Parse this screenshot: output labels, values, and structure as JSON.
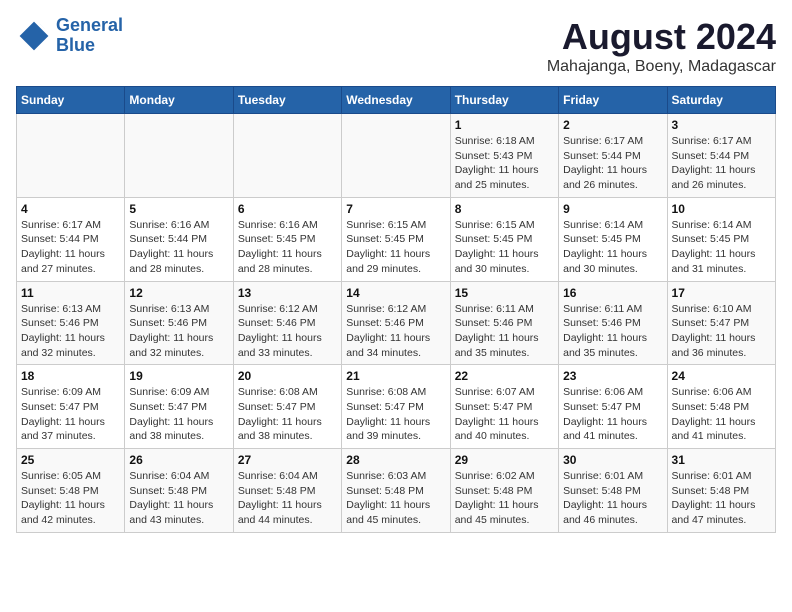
{
  "header": {
    "logo_line1": "General",
    "logo_line2": "Blue",
    "main_title": "August 2024",
    "subtitle": "Mahajanga, Boeny, Madagascar"
  },
  "calendar": {
    "days_of_week": [
      "Sunday",
      "Monday",
      "Tuesday",
      "Wednesday",
      "Thursday",
      "Friday",
      "Saturday"
    ],
    "weeks": [
      [
        {
          "day": "",
          "info": ""
        },
        {
          "day": "",
          "info": ""
        },
        {
          "day": "",
          "info": ""
        },
        {
          "day": "",
          "info": ""
        },
        {
          "day": "1",
          "info": "Sunrise: 6:18 AM\nSunset: 5:43 PM\nDaylight: 11 hours and 25 minutes."
        },
        {
          "day": "2",
          "info": "Sunrise: 6:17 AM\nSunset: 5:44 PM\nDaylight: 11 hours and 26 minutes."
        },
        {
          "day": "3",
          "info": "Sunrise: 6:17 AM\nSunset: 5:44 PM\nDaylight: 11 hours and 26 minutes."
        }
      ],
      [
        {
          "day": "4",
          "info": "Sunrise: 6:17 AM\nSunset: 5:44 PM\nDaylight: 11 hours and 27 minutes."
        },
        {
          "day": "5",
          "info": "Sunrise: 6:16 AM\nSunset: 5:44 PM\nDaylight: 11 hours and 28 minutes."
        },
        {
          "day": "6",
          "info": "Sunrise: 6:16 AM\nSunset: 5:45 PM\nDaylight: 11 hours and 28 minutes."
        },
        {
          "day": "7",
          "info": "Sunrise: 6:15 AM\nSunset: 5:45 PM\nDaylight: 11 hours and 29 minutes."
        },
        {
          "day": "8",
          "info": "Sunrise: 6:15 AM\nSunset: 5:45 PM\nDaylight: 11 hours and 30 minutes."
        },
        {
          "day": "9",
          "info": "Sunrise: 6:14 AM\nSunset: 5:45 PM\nDaylight: 11 hours and 30 minutes."
        },
        {
          "day": "10",
          "info": "Sunrise: 6:14 AM\nSunset: 5:45 PM\nDaylight: 11 hours and 31 minutes."
        }
      ],
      [
        {
          "day": "11",
          "info": "Sunrise: 6:13 AM\nSunset: 5:46 PM\nDaylight: 11 hours and 32 minutes."
        },
        {
          "day": "12",
          "info": "Sunrise: 6:13 AM\nSunset: 5:46 PM\nDaylight: 11 hours and 32 minutes."
        },
        {
          "day": "13",
          "info": "Sunrise: 6:12 AM\nSunset: 5:46 PM\nDaylight: 11 hours and 33 minutes."
        },
        {
          "day": "14",
          "info": "Sunrise: 6:12 AM\nSunset: 5:46 PM\nDaylight: 11 hours and 34 minutes."
        },
        {
          "day": "15",
          "info": "Sunrise: 6:11 AM\nSunset: 5:46 PM\nDaylight: 11 hours and 35 minutes."
        },
        {
          "day": "16",
          "info": "Sunrise: 6:11 AM\nSunset: 5:46 PM\nDaylight: 11 hours and 35 minutes."
        },
        {
          "day": "17",
          "info": "Sunrise: 6:10 AM\nSunset: 5:47 PM\nDaylight: 11 hours and 36 minutes."
        }
      ],
      [
        {
          "day": "18",
          "info": "Sunrise: 6:09 AM\nSunset: 5:47 PM\nDaylight: 11 hours and 37 minutes."
        },
        {
          "day": "19",
          "info": "Sunrise: 6:09 AM\nSunset: 5:47 PM\nDaylight: 11 hours and 38 minutes."
        },
        {
          "day": "20",
          "info": "Sunrise: 6:08 AM\nSunset: 5:47 PM\nDaylight: 11 hours and 38 minutes."
        },
        {
          "day": "21",
          "info": "Sunrise: 6:08 AM\nSunset: 5:47 PM\nDaylight: 11 hours and 39 minutes."
        },
        {
          "day": "22",
          "info": "Sunrise: 6:07 AM\nSunset: 5:47 PM\nDaylight: 11 hours and 40 minutes."
        },
        {
          "day": "23",
          "info": "Sunrise: 6:06 AM\nSunset: 5:47 PM\nDaylight: 11 hours and 41 minutes."
        },
        {
          "day": "24",
          "info": "Sunrise: 6:06 AM\nSunset: 5:48 PM\nDaylight: 11 hours and 41 minutes."
        }
      ],
      [
        {
          "day": "25",
          "info": "Sunrise: 6:05 AM\nSunset: 5:48 PM\nDaylight: 11 hours and 42 minutes."
        },
        {
          "day": "26",
          "info": "Sunrise: 6:04 AM\nSunset: 5:48 PM\nDaylight: 11 hours and 43 minutes."
        },
        {
          "day": "27",
          "info": "Sunrise: 6:04 AM\nSunset: 5:48 PM\nDaylight: 11 hours and 44 minutes."
        },
        {
          "day": "28",
          "info": "Sunrise: 6:03 AM\nSunset: 5:48 PM\nDaylight: 11 hours and 45 minutes."
        },
        {
          "day": "29",
          "info": "Sunrise: 6:02 AM\nSunset: 5:48 PM\nDaylight: 11 hours and 45 minutes."
        },
        {
          "day": "30",
          "info": "Sunrise: 6:01 AM\nSunset: 5:48 PM\nDaylight: 11 hours and 46 minutes."
        },
        {
          "day": "31",
          "info": "Sunrise: 6:01 AM\nSunset: 5:48 PM\nDaylight: 11 hours and 47 minutes."
        }
      ]
    ]
  }
}
